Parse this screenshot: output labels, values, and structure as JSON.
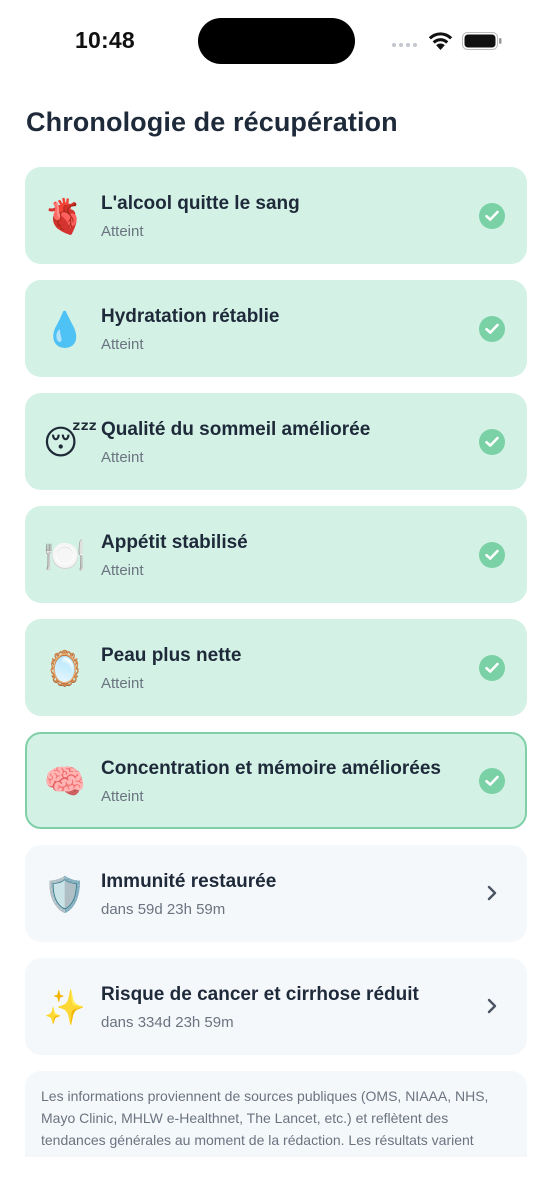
{
  "status_bar": {
    "time": "10:48"
  },
  "title": "Chronologie de récupération",
  "milestones": [
    {
      "emoji": "🫀",
      "icon": "anatomical-heart-icon",
      "name": "L'alcool quitte le sang",
      "status": "Atteint"
    },
    {
      "emoji": "💧",
      "icon": "droplet-icon",
      "name": "Hydratation rétablie",
      "status": "Atteint"
    },
    {
      "emoji": "😴",
      "icon": "sleeping-face-icon",
      "name": "Qualité du sommeil améliorée",
      "status": "Atteint"
    },
    {
      "emoji": "🍽️",
      "icon": "plate-cutlery-icon",
      "name": "Appétit stabilisé",
      "status": "Atteint"
    },
    {
      "emoji": "🪞",
      "icon": "mirror-icon",
      "name": "Peau plus nette",
      "status": "Atteint"
    },
    {
      "emoji": "🧠",
      "icon": "brain-icon",
      "name": "Concentration et mémoire améliorées",
      "status": "Atteint"
    },
    {
      "emoji": "🛡️",
      "icon": "shield-icon",
      "name": "Immunité restaurée",
      "status": "dans 59d 23h 59m"
    },
    {
      "emoji": "✨",
      "icon": "sparkles-icon",
      "name": "Risque de cancer et cirrhose réduit",
      "status": "dans 334d 23h 59m"
    }
  ],
  "disclaimer": "Les informations proviennent de sources publiques (OMS, NIAAA, NHS, Mayo Clinic, MHLW e-Healthnet, The Lancet, etc.) et reflètent des tendances générales au moment de la rédaction. Les résultats varient suivant votre santé, vos médicaments, vos habitudes et",
  "colors": {
    "achieved_bg": "#d3f1e5",
    "active_border": "#7fcfa7",
    "check": "#79d1a5",
    "pending_bg": "#f5f8fb",
    "title": "#1e2a3a",
    "muted": "#6b7380"
  }
}
